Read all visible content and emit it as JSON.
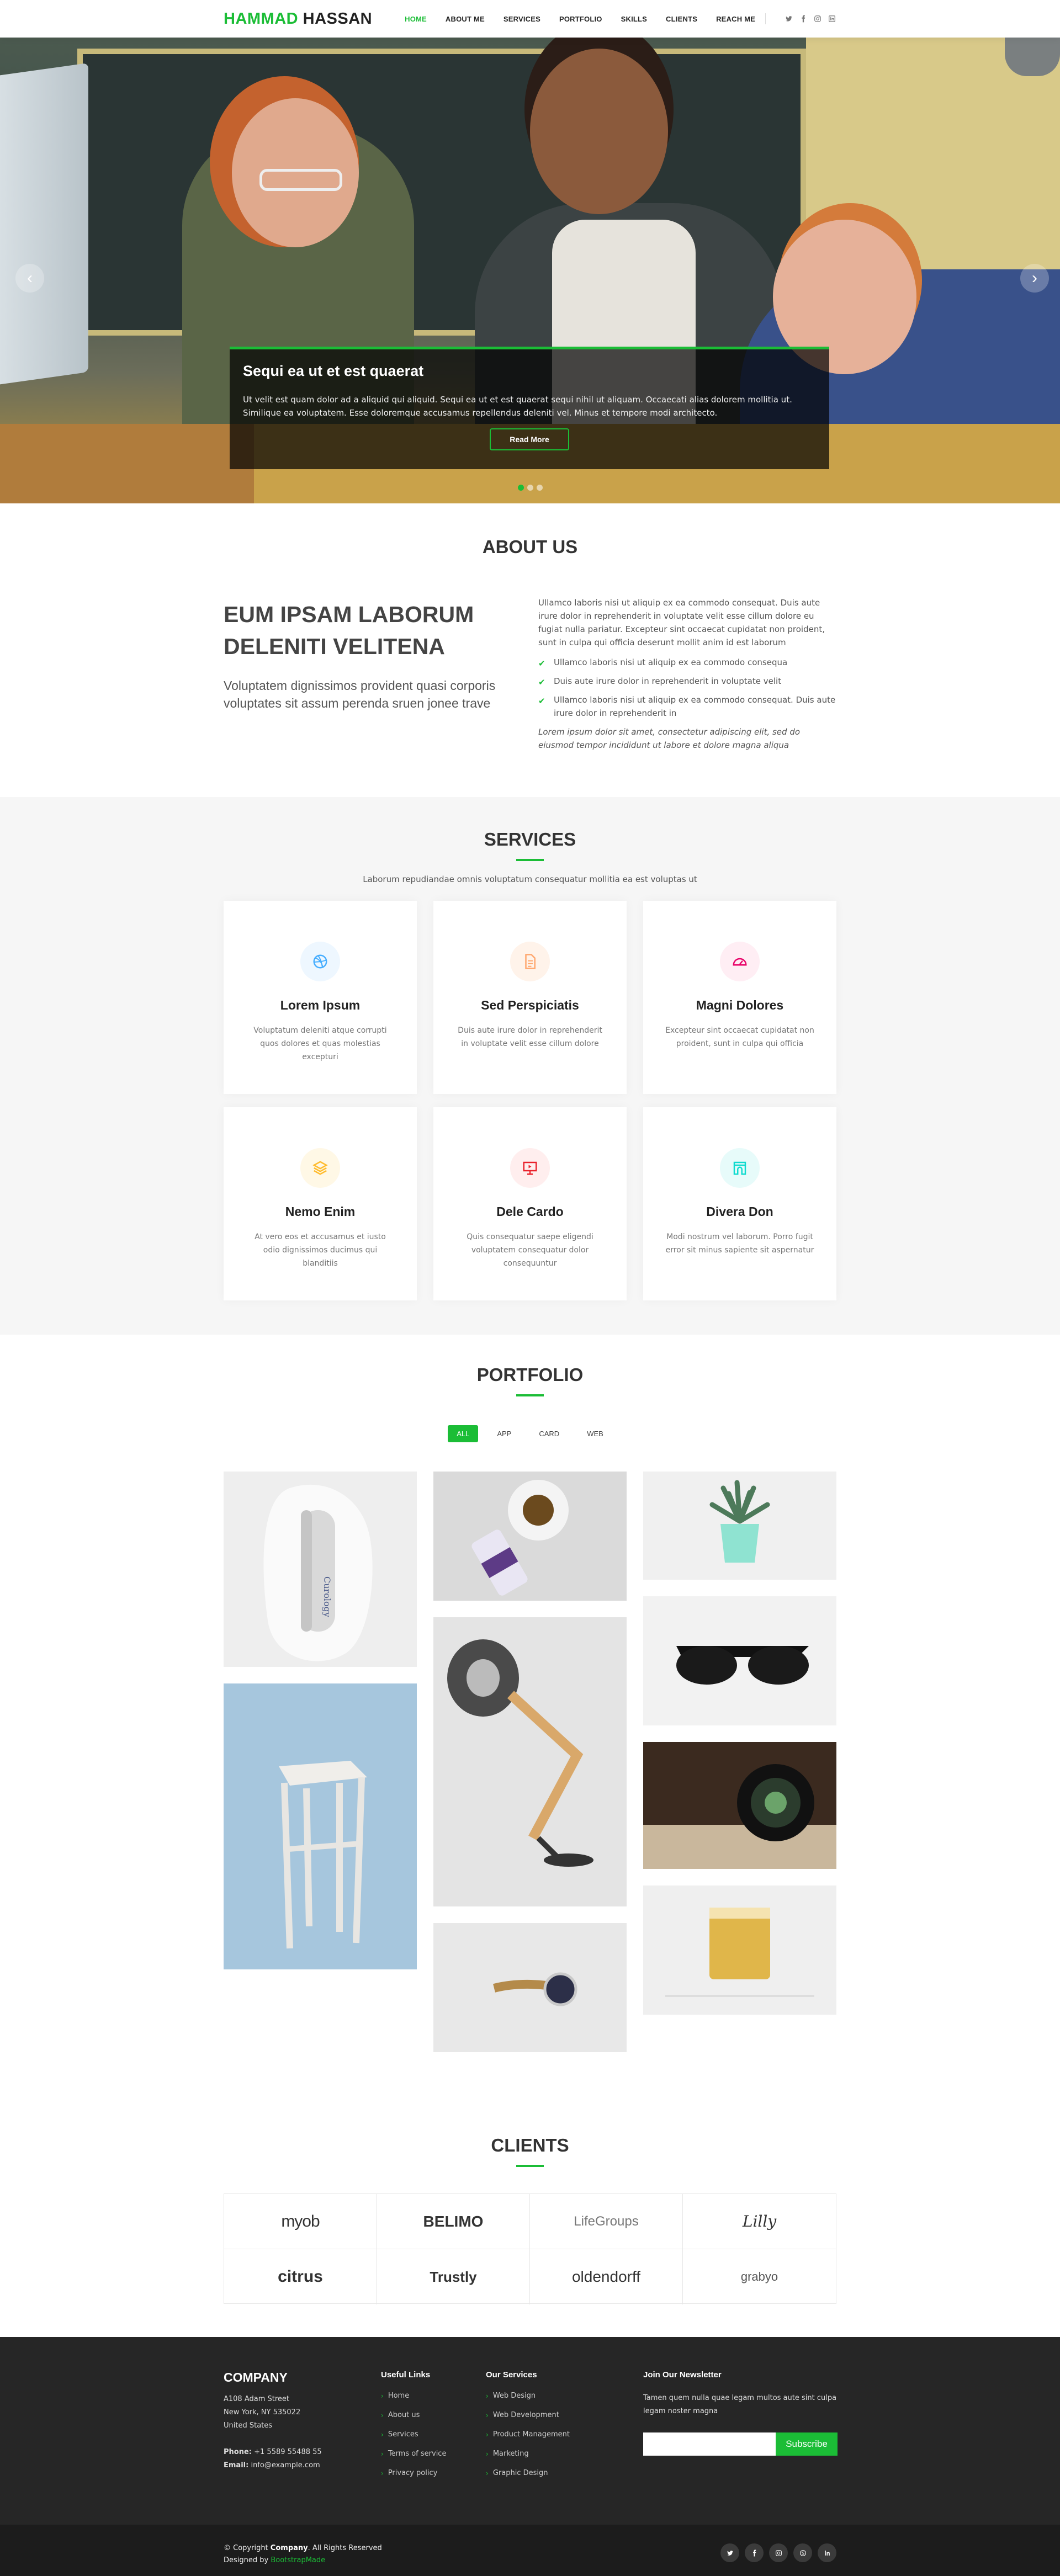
{
  "colors": {
    "accent": "#1bbd36",
    "footer_bg": "#262626"
  },
  "header": {
    "logo_first": "Hammad",
    "logo_last": "Hassan",
    "nav": [
      "Home",
      "About Me",
      "Services",
      "Portfolio",
      "Skills",
      "Clients",
      "Reach Me"
    ],
    "social_icons": [
      "twitter-icon",
      "facebook-icon",
      "instagram-icon",
      "linkedin-icon"
    ]
  },
  "hero": {
    "title": "Sequi ea ut et est quaerat",
    "text": "Ut velit est quam dolor ad a aliquid qui aliquid. Sequi ea ut et est quaerat sequi nihil ut aliquam. Occaecati alias dolorem mollitia ut. Similique ea voluptatem. Esse doloremque accusamus repellendus deleniti vel. Minus et tempore modi architecto.",
    "button": "Read More",
    "prev": "‹",
    "next": "›",
    "slides": 3,
    "active_slide": 1
  },
  "about": {
    "title": "About Us",
    "heading": "Eum ipsam laborum deleniti velitena",
    "subheading": "Voluptatem dignissimos provident quasi corporis voluptates sit assum perenda sruen jonee trave",
    "paragraph": "Ullamco laboris nisi ut aliquip ex ea commodo consequat. Duis aute irure dolor in reprehenderit in voluptate velit esse cillum dolore eu fugiat nulla pariatur. Excepteur sint occaecat cupidatat non proident, sunt in culpa qui officia deserunt mollit anim id est laborum",
    "list": [
      "Ullamco laboris nisi ut aliquip ex ea commodo consequa",
      "Duis aute irure dolor in reprehenderit in voluptate velit",
      "Ullamco laboris nisi ut aliquip ex ea commodo consequat. Duis aute irure dolor in reprehenderit in"
    ],
    "italic": "Lorem ipsum dolor sit amet, consectetur adipiscing elit, sed do eiusmod tempor incididunt ut labore et dolore magna aliqua"
  },
  "services": {
    "title": "Services",
    "subtitle": "Laborum repudiandae omnis voluptatum consequatur mollitia ea est voluptas ut",
    "items": [
      {
        "icon": "dribbble-icon",
        "color": "#47aeff",
        "title": "Lorem Ipsum",
        "text": "Voluptatum deleniti atque corrupti quos dolores et quas molestias excepturi"
      },
      {
        "icon": "file-icon",
        "color": "#ffa76e",
        "title": "Sed Perspiciatis",
        "text": "Duis aute irure dolor in reprehenderit in voluptate velit esse cillum dolore"
      },
      {
        "icon": "tachometer-icon",
        "color": "#e80368",
        "title": "Magni Dolores",
        "text": "Excepteur sint occaecat cupidatat non proident, sunt in culpa qui officia"
      },
      {
        "icon": "layer-icon",
        "color": "#ffbb2c",
        "title": "Nemo Enim",
        "text": "At vero eos et accusamus et iusto odio dignissimos ducimus qui blanditiis"
      },
      {
        "icon": "slideshow-icon",
        "color": "#e9222c",
        "title": "Dele Cardo",
        "text": "Quis consequatur saepe eligendi voluptatem consequatur dolor consequuntur"
      },
      {
        "icon": "arch-icon",
        "color": "#11dbcf",
        "title": "Divera Don",
        "text": "Modi nostrum vel laborum. Porro fugit error sit minus sapiente sit aspernatur"
      }
    ]
  },
  "portfolio": {
    "title": "Portfolio",
    "filters": [
      "All",
      "App",
      "Card",
      "Web"
    ],
    "active_filter": "All",
    "items": [
      "cosmetic-bottle",
      "coffee-and-tube",
      "potted-plant",
      "desk-lamp",
      "sunglasses",
      "wooden-stool",
      "camera-lens",
      "wristwatch",
      "glass-of-whisky"
    ]
  },
  "clients": {
    "title": "Clients",
    "logos": [
      "myob",
      "BELIMO",
      "LifeGroups",
      "Lilly",
      "citrus",
      "Trustly",
      "oldendorff",
      "grabyo"
    ]
  },
  "footer": {
    "company": "Company",
    "address1": "A108 Adam Street",
    "address2": "New York, NY 535022",
    "address3": "United States",
    "phone_label": "Phone:",
    "phone": "+1 5589 55488 55",
    "email_label": "Email:",
    "email": "info@example.com",
    "useful_title": "Useful Links",
    "useful_links": [
      "Home",
      "About us",
      "Services",
      "Terms of service",
      "Privacy policy"
    ],
    "services_title": "Our Services",
    "services_links": [
      "Web Design",
      "Web Development",
      "Product Management",
      "Marketing",
      "Graphic Design"
    ],
    "newsletter_title": "Join Our Newsletter",
    "newsletter_text": "Tamen quem nulla quae legam multos aute sint culpa legam noster magna",
    "subscribe": "Subscribe",
    "copyright_prefix": "© Copyright",
    "copyright_company": "Company",
    "copyright_suffix": ". All Rights Reserved",
    "designed_by": "Designed by",
    "designer": "BootstrapMade",
    "social": [
      "twitter-icon",
      "facebook-icon",
      "instagram-icon",
      "skype-icon",
      "linkedin-icon"
    ]
  }
}
